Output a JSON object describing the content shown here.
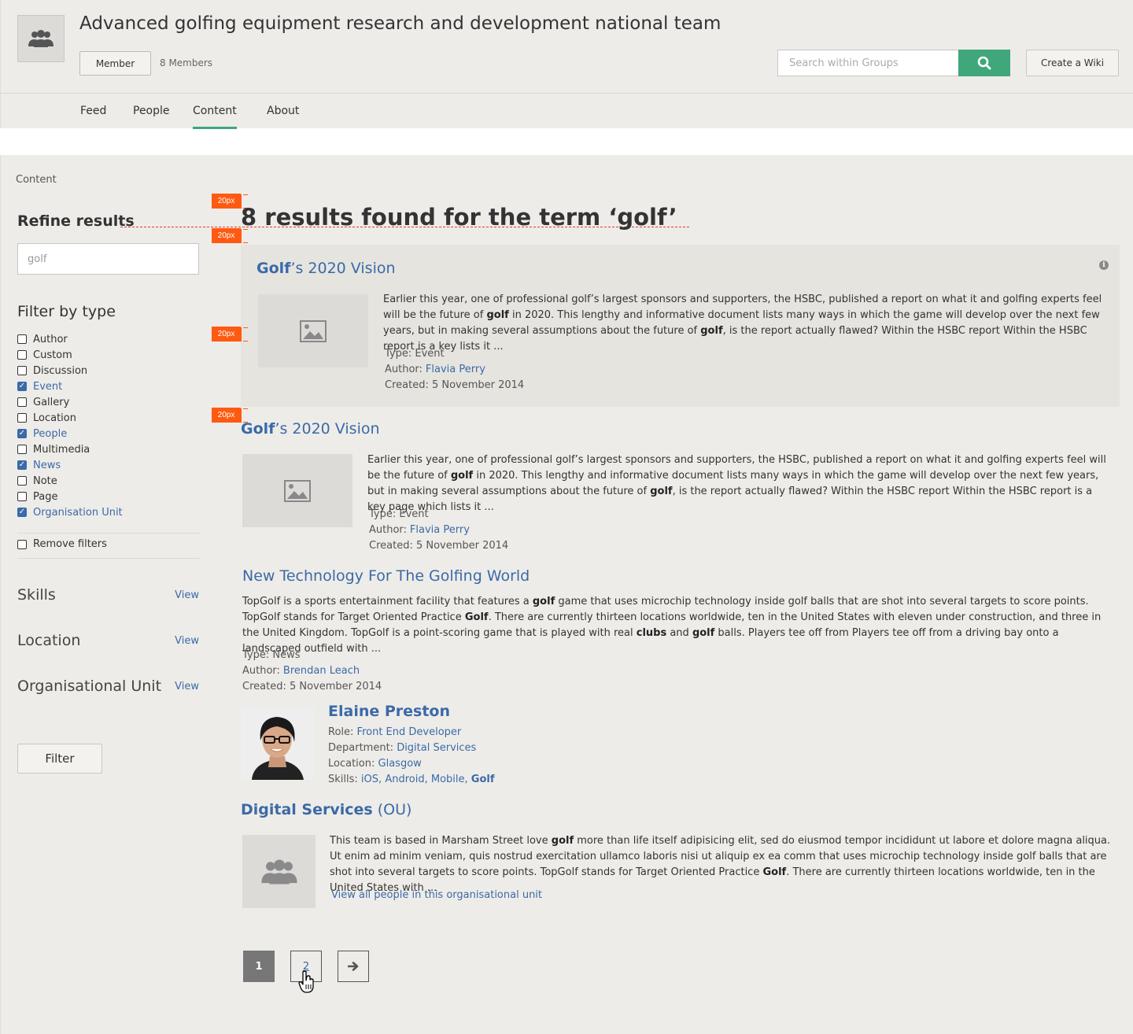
{
  "header": {
    "group_title": "Advanced golfing equipment research and development national team",
    "member_button": "Member",
    "member_count": "8 Members",
    "search_placeholder": "Search within Groups",
    "create_wiki": "Create a Wiki"
  },
  "tabs": [
    {
      "label": "Feed"
    },
    {
      "label": "People"
    },
    {
      "label": "Content",
      "active": true
    },
    {
      "label": "About"
    }
  ],
  "breadcrumb": "Content",
  "sidebar": {
    "refine_title": "Refine results",
    "refine_value": "golf",
    "filter_title": "Filter by type",
    "filters": [
      {
        "label": "Author",
        "checked": false
      },
      {
        "label": "Custom",
        "checked": false
      },
      {
        "label": "Discussion",
        "checked": false
      },
      {
        "label": "Event",
        "checked": true
      },
      {
        "label": "Gallery",
        "checked": false
      },
      {
        "label": "Location",
        "checked": false
      },
      {
        "label": "People",
        "checked": true
      },
      {
        "label": "Multimedia",
        "checked": false
      },
      {
        "label": "News",
        "checked": true
      },
      {
        "label": "Note",
        "checked": false
      },
      {
        "label": "Page",
        "checked": false
      },
      {
        "label": "Organisation Unit",
        "checked": true
      }
    ],
    "remove_filters": "Remove filters",
    "facets": [
      {
        "label": "Skills",
        "view": "View"
      },
      {
        "label": "Location",
        "view": "View"
      },
      {
        "label": "Organisational Unit",
        "view": "View"
      }
    ],
    "filter_button": "Filter"
  },
  "results": {
    "heading": "8 results found for the term ‘golf’",
    "spacing_badge": "20px",
    "item1": {
      "title_bold": "Golf",
      "title_rest": "’s 2020 Vision",
      "text_1": "Earlier this year, one of professional golf’s largest sponsors and supporters, the HSBC, published a report on what it and golfing experts feel will be the future of ",
      "bold_1": "golf",
      "text_2": " in 2020. This lengthy and informative document lists many ways in which the game will develop over the next few years, but in making several assumptions about the future of ",
      "bold_2": "golf",
      "text_3": ", is the report actually flawed?  Within the HSBC report  Within the HSBC report is a key lists it ...",
      "type": "Type: Event",
      "author_label": "Author:",
      "author": "Flavia Perry",
      "created": "Created: 5 November 2014"
    },
    "item2": {
      "title_bold": "Golf",
      "title_rest": "’s 2020 Vision",
      "text_1": "Earlier this year, one of professional golf’s largest sponsors and supporters, the HSBC, published a report on what it and golfing experts feel will be the future of ",
      "bold_1": "golf",
      "text_2": " in 2020. This lengthy and informative document lists many ways in which the game will develop over the next few years, but in making several assumptions about the future of ",
      "bold_2": "golf",
      "text_3": ", is the report actually flawed?  Within the HSBC report  Within the HSBC report is a key page which lists it ...",
      "type": "Type: Event",
      "author_label": "Author:",
      "author": "Flavia Perry",
      "created": "Created: 5 November 2014"
    },
    "item3": {
      "title": "New Technology For The Golfing World",
      "t1": "TopGolf is a sports entertainment facility that features a ",
      "b1": "golf",
      "t2": " game that uses microchip technology inside golf balls that are shot into several targets to score points. TopGolf stands for Target Oriented Practice ",
      "b2": "Golf",
      "t3": ". There are currently thirteen locations worldwide, ten in the United States with eleven under construction, and three in the United Kingdom. TopGolf is a point-scoring game that is played with real ",
      "b3": "clubs",
      "t4": " and ",
      "b4": "golf",
      "t5": " balls. Players tee off from Players tee off from a driving bay onto a landscaped outfield with ...",
      "type": "Type: News",
      "author_label": "Author:",
      "author": "Brendan Leach",
      "created": "Created: 5 November 2014"
    },
    "person": {
      "name": "Elaine Preston",
      "role_label": "Role:",
      "role": "Front End Developer",
      "dept_label": "Department:",
      "dept": "Digital Services",
      "loc_label": "Location:",
      "loc": "Glasgow",
      "skills_label": "Skills:",
      "skill_1": "iOS",
      "skill_2": "Android",
      "skill_3": "Mobile",
      "skill_4": "Golf",
      "comma": ","
    },
    "ou": {
      "title_bold": "Digital Services",
      "title_rest": " (OU)",
      "t1": "This team is based in Marsham Street love ",
      "b1": "golf",
      "t2": " more than life itself adipisicing elit, sed do eiusmod tempor incididunt ut labore et dolore magna aliqua. Ut enim ad minim veniam, quis nostrud exercitation ullamco laboris nisi ut aliquip ex ea comm that uses microchip technology inside golf balls that are shot into several targets to score points. TopGolf stands for Target Oriented Practice ",
      "b2": "Golf",
      "t3": ". There are currently thirteen locations worldwide, ten in the United States with ...",
      "view_all": "View all people in this organisational unit"
    }
  },
  "pagination": {
    "page_1": "1",
    "page_2": "2",
    "next_icon": "arrow-right-icon"
  },
  "colors": {
    "accent_green": "#3fa77a",
    "link_blue": "#3a6aa8",
    "spacing_orange": "#ff5a12",
    "background": "#eeece8"
  }
}
